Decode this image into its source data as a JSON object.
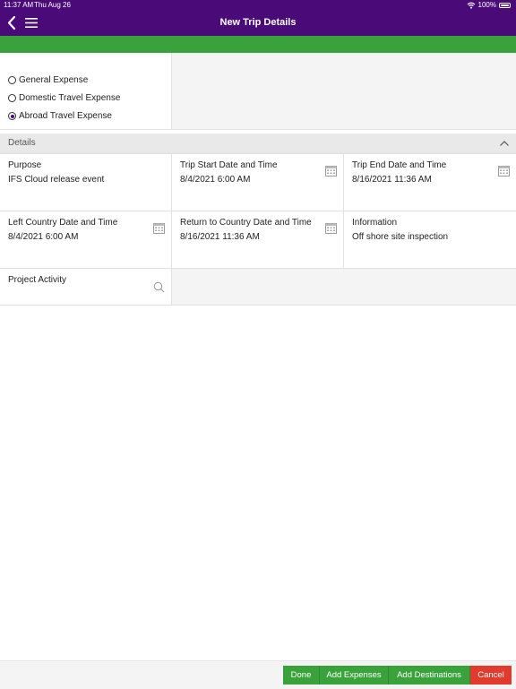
{
  "status_bar": {
    "time": "11:37 AM",
    "date": "Thu Aug 26",
    "battery": "100%"
  },
  "header": {
    "title": "New Trip Details",
    "back_icon": "chevron-left-icon",
    "menu_icon": "hamburger-menu-icon",
    "color": "#4a0a78"
  },
  "accent_bar_color": "#3aa23a",
  "expense_types": [
    {
      "label": "General Expense",
      "selected": false
    },
    {
      "label": "Domestic Travel Expense",
      "selected": false
    },
    {
      "label": "Abroad Travel Expense",
      "selected": true
    }
  ],
  "details": {
    "section_label": "Details",
    "purpose": {
      "label": "Purpose",
      "value": "IFS Cloud release event"
    },
    "trip_start": {
      "label": "Trip Start Date and Time",
      "value": "8/4/2021 6:00 AM"
    },
    "trip_end": {
      "label": "Trip End Date and Time",
      "value": "8/16/2021 11:36 AM"
    },
    "left_country": {
      "label": "Left Country Date and Time",
      "value": "8/4/2021 6:00 AM"
    },
    "return_country": {
      "label": "Return to Country Date and Time",
      "value": "8/16/2021 11:36 AM"
    },
    "information": {
      "label": "Information",
      "value": "Off shore site inspection"
    },
    "project_activity": {
      "label": "Project Activity",
      "value": ""
    }
  },
  "actions": {
    "done": "Done",
    "add_expenses": "Add Expenses",
    "add_destinations": "Add Destinations",
    "cancel": "Cancel",
    "primary_color": "#3aa23a",
    "danger_color": "#e23b2e"
  }
}
